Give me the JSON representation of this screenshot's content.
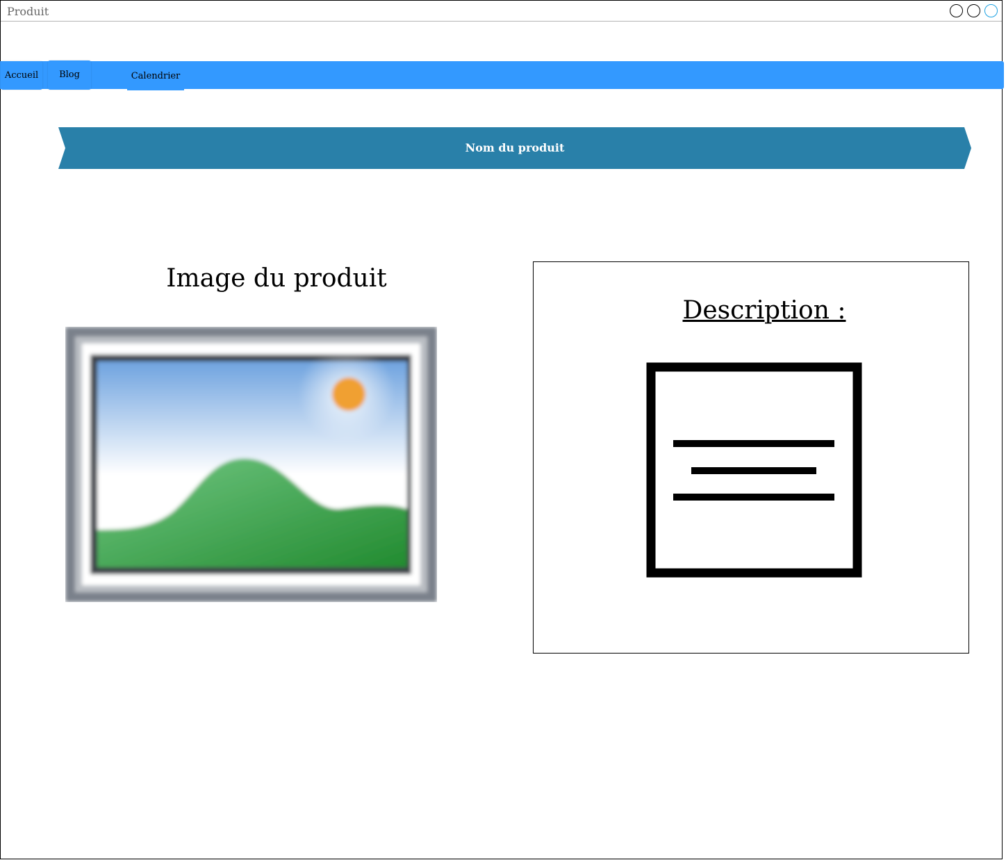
{
  "window": {
    "title": "Produit"
  },
  "nav": {
    "items": [
      {
        "label": "Accueil"
      },
      {
        "label": "Blog"
      },
      {
        "label": "Calendrier"
      }
    ]
  },
  "banner": {
    "title": "Nom du produit",
    "color": "#2980a9"
  },
  "image_section": {
    "label": "Image du produit",
    "icon": "image-placeholder-icon"
  },
  "description": {
    "title": "Description :",
    "icon": "text-document-icon"
  },
  "colors": {
    "nav_bg": "#3399ff",
    "banner_bg": "#2980a9"
  }
}
